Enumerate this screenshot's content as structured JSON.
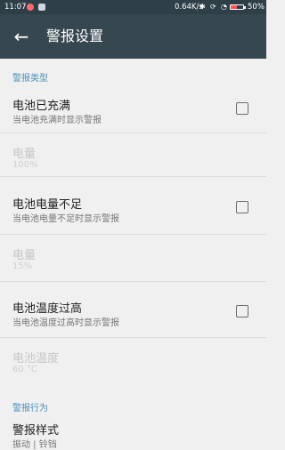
{
  "status_bar": {
    "time": "11:07",
    "network_speed": "0.64K/s",
    "battery_percent": "50%",
    "battery_level": 0.5,
    "icons": [
      "notification-icon",
      "screenshot-icon",
      "bluetooth-icon",
      "sync-icon",
      "wifi-icon",
      "battery-icon"
    ]
  },
  "app_bar": {
    "back_icon": "←",
    "title": "警报设置"
  },
  "sections": {
    "alarm_type": "警报类型",
    "alarm_behavior": "警报行为"
  },
  "prefs": {
    "battery_full": {
      "title": "电池已充满",
      "summary": "当电池充满时显示警报",
      "checked": false
    },
    "full_level": {
      "title": "电量",
      "summary": "100%"
    },
    "battery_low": {
      "title": "电池电量不足",
      "summary": "当电池电量不足时显示警报",
      "checked": false
    },
    "low_level": {
      "title": "电量",
      "summary": "15%"
    },
    "battery_hot": {
      "title": "电池温度过高",
      "summary": "当电池温度过高时显示警报",
      "checked": false
    },
    "temperature": {
      "title": "电池温度",
      "summary": "60 °C"
    },
    "alarm_style": {
      "title": "警报样式",
      "summary": "振动 | 铃铛"
    }
  },
  "colors": {
    "app_bar": "#37474f",
    "status_bar": "#2f3f48",
    "section_header": "#4a90b8",
    "background": "#f0f0f0"
  }
}
